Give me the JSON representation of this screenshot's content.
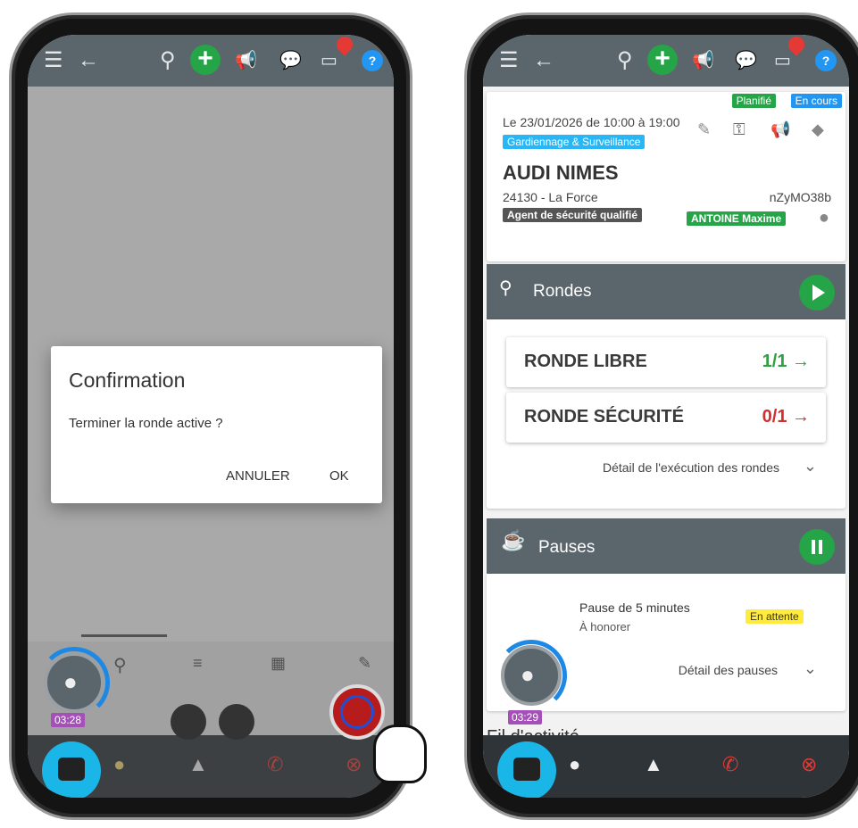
{
  "left": {
    "dialog": {
      "title": "Confirmation",
      "message": "Terminer la ronde active ?",
      "cancel": "ANNULER",
      "ok": "OK"
    },
    "timer": "03:28"
  },
  "right": {
    "mission": {
      "schedule": "Le 23/01/2026 de 10:00 à 19:00",
      "category": "Gardiennage & Surveillance",
      "site": "AUDI NIMES",
      "location": "24130 - La Force",
      "code": "nZyMO38b",
      "qualification": "Agent de sécurité qualifié",
      "agent": "ANTOINE Maxime",
      "status_planned": "Planifié",
      "status_ongoing": "En cours"
    },
    "rondes": {
      "title": "Rondes",
      "items": [
        {
          "name": "RONDE LIBRE",
          "count": "1/1 →",
          "color": "#2ea043"
        },
        {
          "name": "RONDE SÉCURITÉ",
          "count": "0/1 →",
          "color": "#d32f2f"
        }
      ],
      "detail": "Détail de l'exécution des rondes"
    },
    "pauses": {
      "title": "Pauses",
      "item": "Pause de 5 minutes",
      "sub": "À honorer",
      "status": "En attente",
      "detail": "Détail des pauses"
    },
    "feed_title": "Fil d'activité",
    "timer": "03:29"
  },
  "colors": {
    "header": "#5a666c",
    "green": "#25a448",
    "blue": "#2196f3",
    "nav": "#2e3437",
    "fab": "#1bb6e8"
  }
}
